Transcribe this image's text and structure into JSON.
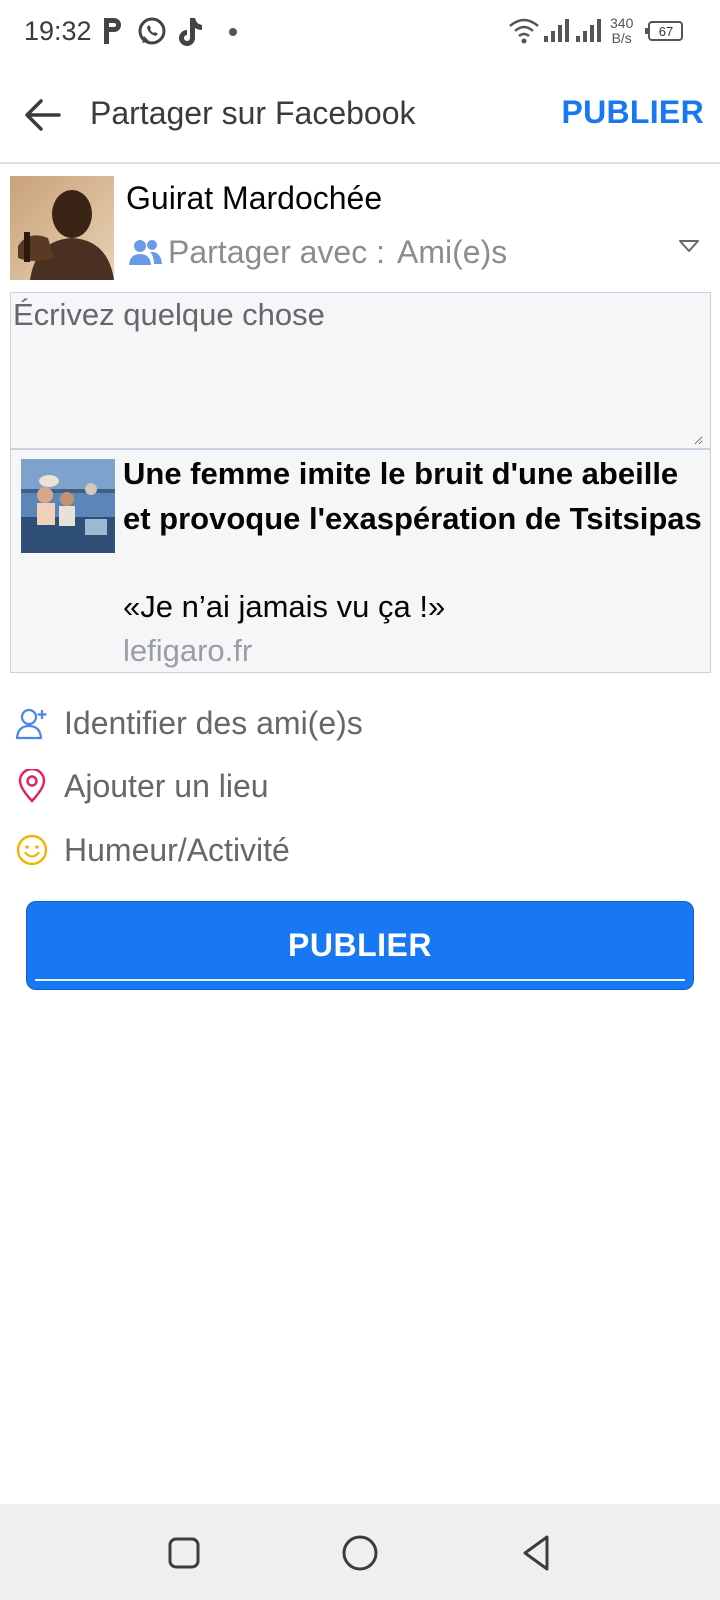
{
  "status_bar": {
    "time": "19:32",
    "net_rate_value": "340",
    "net_rate_unit": "B/s",
    "battery": "67",
    "icons": [
      "parking-p-icon",
      "whatsapp-icon",
      "tiktok-icon",
      "wifi-icon",
      "signal-icon",
      "signal-icon-2",
      "battery-icon"
    ]
  },
  "appbar": {
    "title": "Partager sur Facebook",
    "publish_label": "PUBLIER",
    "back_icon": "arrow-left-icon"
  },
  "user": {
    "name": "Guirat Mardochée",
    "share_label": "Partager avec :",
    "share_value": "Ami(e)s",
    "share_icon": "people-icon"
  },
  "composer": {
    "placeholder": "Écrivez quelque chose",
    "link": {
      "title": "Une femme imite le bruit d'une abeille et provoque l'exaspération de Tsitsipas",
      "description": "«Je n’ai jamais vu ça !»",
      "domain": "lefigaro.fr"
    }
  },
  "options": [
    {
      "label": "Identifier des ami(e)s",
      "icon": "tag-friend-icon"
    },
    {
      "label": "Ajouter un lieu",
      "icon": "location-pin-icon"
    },
    {
      "label": "Humeur/Activité",
      "icon": "smiley-icon"
    }
  ],
  "publish_button": {
    "label": "PUBLIER"
  },
  "colors": {
    "accent": "#1877f2",
    "location": "#e41e5c",
    "smiley": "#f0b400",
    "text_secondary": "#65676b"
  },
  "navbar": {
    "icons": [
      "recent-apps-icon",
      "home-icon",
      "back-icon"
    ]
  }
}
